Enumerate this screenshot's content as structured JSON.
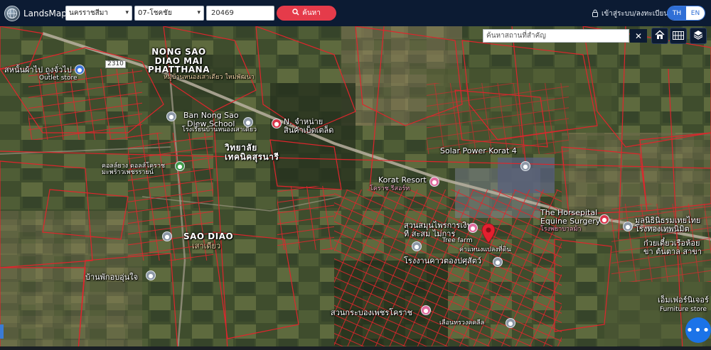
{
  "brand": {
    "name": "LandsMaps"
  },
  "filters": {
    "province": "นครราชสีมา",
    "district": "07-โชคชัย",
    "parcel_no": "20469"
  },
  "actions": {
    "search_label": "ค้นหา"
  },
  "account": {
    "login_label": "เข้าสู่ระบบ/ลงทะเบียน"
  },
  "language": {
    "options": [
      "TH",
      "EN"
    ],
    "selected": "TH"
  },
  "map": {
    "search_placeholder": "ค้นหาสถานที่สำคัญ",
    "labels": {
      "village_north": "NONG SAO\nDIAO MAI\nPHATTHANA",
      "village_north_th": "หมู่บ้านหนองเสาเดียว\nใหม่พัฒนา",
      "village_south": "SAO DIAO",
      "village_south_th": "เสาเดียว",
      "outlet_th": "สหนั้นผ้าไป ถูงจั่วไป",
      "outlet_en": "Outlet store",
      "school_1": "Ban Nong Sao\nDiew School",
      "school_1_th": "โรงเรียนบ้านหนองเสาเดียว",
      "shop_n": "N. จำหน่าย\nสินค้าเบ็ดเตล็ด",
      "college": "วิทยาลัย\nเทคนิคสุรนารี",
      "dorm": "คอลล์ยาง ดอลส์โคราช\nมะพร้าวเพชรรายน์",
      "solar": "Solar Power Korat 4",
      "korat_resort": "Korat Resort",
      "korat_resort_th": "โคราช รีสอร์ท",
      "hospital": "The Horsepital\nEquine Surgery",
      "hospital_th": "โรงพยาบาลม้า",
      "park": "สวนสมุนไพรการเงิน\nที่ สะสม ไม่การ",
      "tree_farm": "Tree farm",
      "plant_shop": "ค่าแหนงแปลงที่ดิน",
      "factory": "โรงงานคาวตองปศุสัตว์",
      "house": "บ้านพักอบอุ่นใจ",
      "garden_south": "สวนกระบองเพชรโคราช",
      "south_shop": "เลือนทรวงคคลีล",
      "foundation": "มูลนิธินิธรมเทยไทย\nโรงทองเทพนิมิต",
      "noodle": "ก๋วยเตี๋ยวเรือห้อย\nขา ต้นตาล สาขา",
      "furniture": "เอ็มเฟอร์นิเจอร์",
      "furniture_en": "Furniture store",
      "road_no": "2310"
    }
  },
  "colors": {
    "topbar": "#0c1b33",
    "search_button": "#e53b4a",
    "lang_active": "#2f6fd6",
    "parcel_lines": "#e0252c",
    "marker": "#e3202f",
    "fab": "#1b73e8"
  },
  "icons": {
    "brand": "globe-icon",
    "search": "magnifier-icon",
    "user": "user-icon",
    "home": "home-icon",
    "grid": "grid-icon",
    "layers": "layers-icon",
    "marker": "map-pin-icon",
    "more": "ellipsis-icon"
  }
}
